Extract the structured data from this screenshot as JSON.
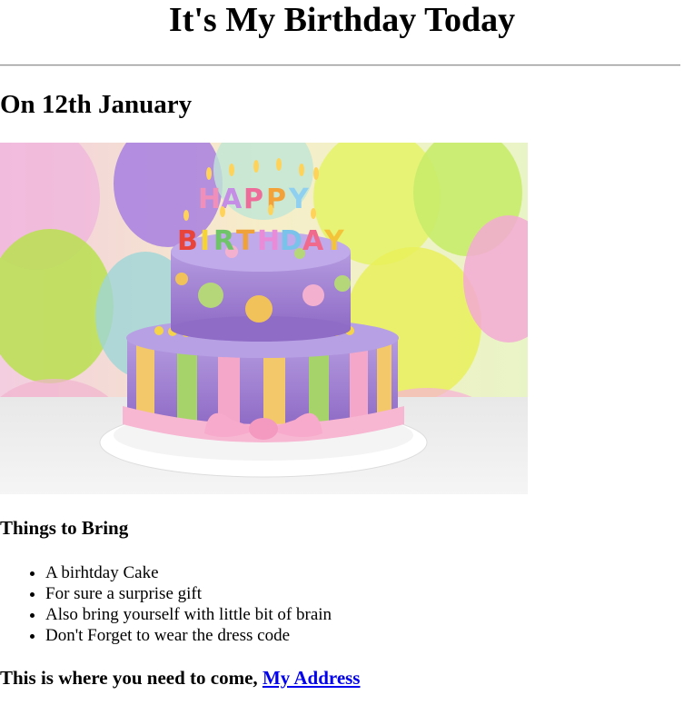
{
  "page": {
    "title": "It's My Birthday Today",
    "date_heading": "On 12th January"
  },
  "image": {
    "description_icon": "birthday-cake-image",
    "candle_letters": "HAPPY BIRTHDAY"
  },
  "bring": {
    "heading": "Things to Bring",
    "items": [
      "A birhtday Cake",
      "For sure a surprise gift",
      "Also bring yourself with little bit of brain",
      "Don't Forget to wear the dress code"
    ]
  },
  "footer": {
    "text": "This is where you need to come, ",
    "link_label": "My Address"
  },
  "colors": {
    "link": "#0000ee",
    "rule": "#8e8e8e"
  }
}
